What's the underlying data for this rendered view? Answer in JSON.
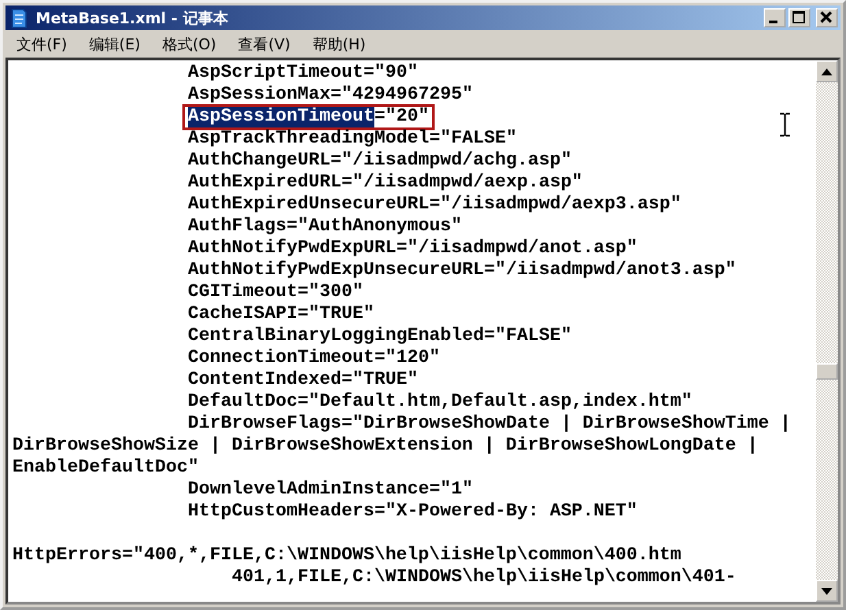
{
  "window": {
    "title": "MetaBase1.xml - 记事本"
  },
  "menu": [
    {
      "label": "文件(F)"
    },
    {
      "label": "编辑(E)"
    },
    {
      "label": "格式(O)"
    },
    {
      "label": "查看(V)"
    },
    {
      "label": "帮助(H)"
    }
  ],
  "lines": [
    {
      "kind": "attribute",
      "segments": [
        {
          "text": "AspScriptTimeout=\"90\"",
          "selected": false
        }
      ],
      "boxed": false
    },
    {
      "kind": "attribute",
      "segments": [
        {
          "text": "AspSessionMax=\"4294967295\"",
          "selected": false
        }
      ],
      "boxed": false
    },
    {
      "kind": "attribute",
      "segments": [
        {
          "text": "AspSessionTimeout",
          "selected": true
        },
        {
          "text": "=\"20\"",
          "selected": false
        }
      ],
      "boxed": true
    },
    {
      "kind": "attribute",
      "segments": [
        {
          "text": "AspTrackThreadingModel=\"FALSE\"",
          "selected": false
        }
      ],
      "boxed": false
    },
    {
      "kind": "attribute",
      "segments": [
        {
          "text": "AuthChangeURL=\"/iisadmpwd/achg.asp\"",
          "selected": false
        }
      ],
      "boxed": false
    },
    {
      "kind": "attribute",
      "segments": [
        {
          "text": "AuthExpiredURL=\"/iisadmpwd/aexp.asp\"",
          "selected": false
        }
      ],
      "boxed": false
    },
    {
      "kind": "attribute",
      "segments": [
        {
          "text": "AuthExpiredUnsecureURL=\"/iisadmpwd/aexp3.asp\"",
          "selected": false
        }
      ],
      "boxed": false
    },
    {
      "kind": "attribute",
      "segments": [
        {
          "text": "AuthFlags=\"AuthAnonymous\"",
          "selected": false
        }
      ],
      "boxed": false
    },
    {
      "kind": "attribute",
      "segments": [
        {
          "text": "AuthNotifyPwdExpURL=\"/iisadmpwd/anot.asp\"",
          "selected": false
        }
      ],
      "boxed": false
    },
    {
      "kind": "attribute",
      "segments": [
        {
          "text": "AuthNotifyPwdExpUnsecureURL=\"/iisadmpwd/anot3.asp\"",
          "selected": false
        }
      ],
      "boxed": false
    },
    {
      "kind": "attribute",
      "segments": [
        {
          "text": "CGITimeout=\"300\"",
          "selected": false
        }
      ],
      "boxed": false
    },
    {
      "kind": "attribute",
      "segments": [
        {
          "text": "CacheISAPI=\"TRUE\"",
          "selected": false
        }
      ],
      "boxed": false
    },
    {
      "kind": "attribute",
      "segments": [
        {
          "text": "CentralBinaryLoggingEnabled=\"FALSE\"",
          "selected": false
        }
      ],
      "boxed": false
    },
    {
      "kind": "attribute",
      "segments": [
        {
          "text": "ConnectionTimeout=\"120\"",
          "selected": false
        }
      ],
      "boxed": false
    },
    {
      "kind": "attribute",
      "segments": [
        {
          "text": "ContentIndexed=\"TRUE\"",
          "selected": false
        }
      ],
      "boxed": false
    },
    {
      "kind": "attribute",
      "segments": [
        {
          "text": "DefaultDoc=\"Default.htm,Default.asp,index.htm\"",
          "selected": false
        }
      ],
      "boxed": false
    },
    {
      "kind": "attribute",
      "segments": [
        {
          "text": "DirBrowseFlags=\"DirBrowseShowDate | DirBrowseShowTime |",
          "selected": false
        }
      ],
      "boxed": false
    },
    {
      "kind": "wrapped",
      "segments": [
        {
          "text": "DirBrowseShowSize | DirBrowseShowExtension | DirBrowseShowLongDate |",
          "selected": false
        }
      ],
      "boxed": false
    },
    {
      "kind": "wrapped",
      "segments": [
        {
          "text": "EnableDefaultDoc\"",
          "selected": false
        }
      ],
      "boxed": false
    },
    {
      "kind": "attribute",
      "segments": [
        {
          "text": "DownlevelAdminInstance=\"1\"",
          "selected": false
        }
      ],
      "boxed": false
    },
    {
      "kind": "attribute",
      "segments": [
        {
          "text": "HttpCustomHeaders=\"X-Powered-By: ASP.NET\"",
          "selected": false
        }
      ],
      "boxed": false
    },
    {
      "kind": "blank"
    },
    {
      "kind": "wrapped",
      "segments": [
        {
          "text": "HttpErrors=\"400,*,FILE,C:\\WINDOWS\\help\\iisHelp\\common\\400.htm",
          "selected": false
        }
      ],
      "boxed": false
    },
    {
      "kind": "continuation",
      "segments": [
        {
          "text": "401,1,FILE,C:\\WINDOWS\\help\\iisHelp\\common\\401-",
          "selected": false
        }
      ],
      "boxed": false
    }
  ]
}
